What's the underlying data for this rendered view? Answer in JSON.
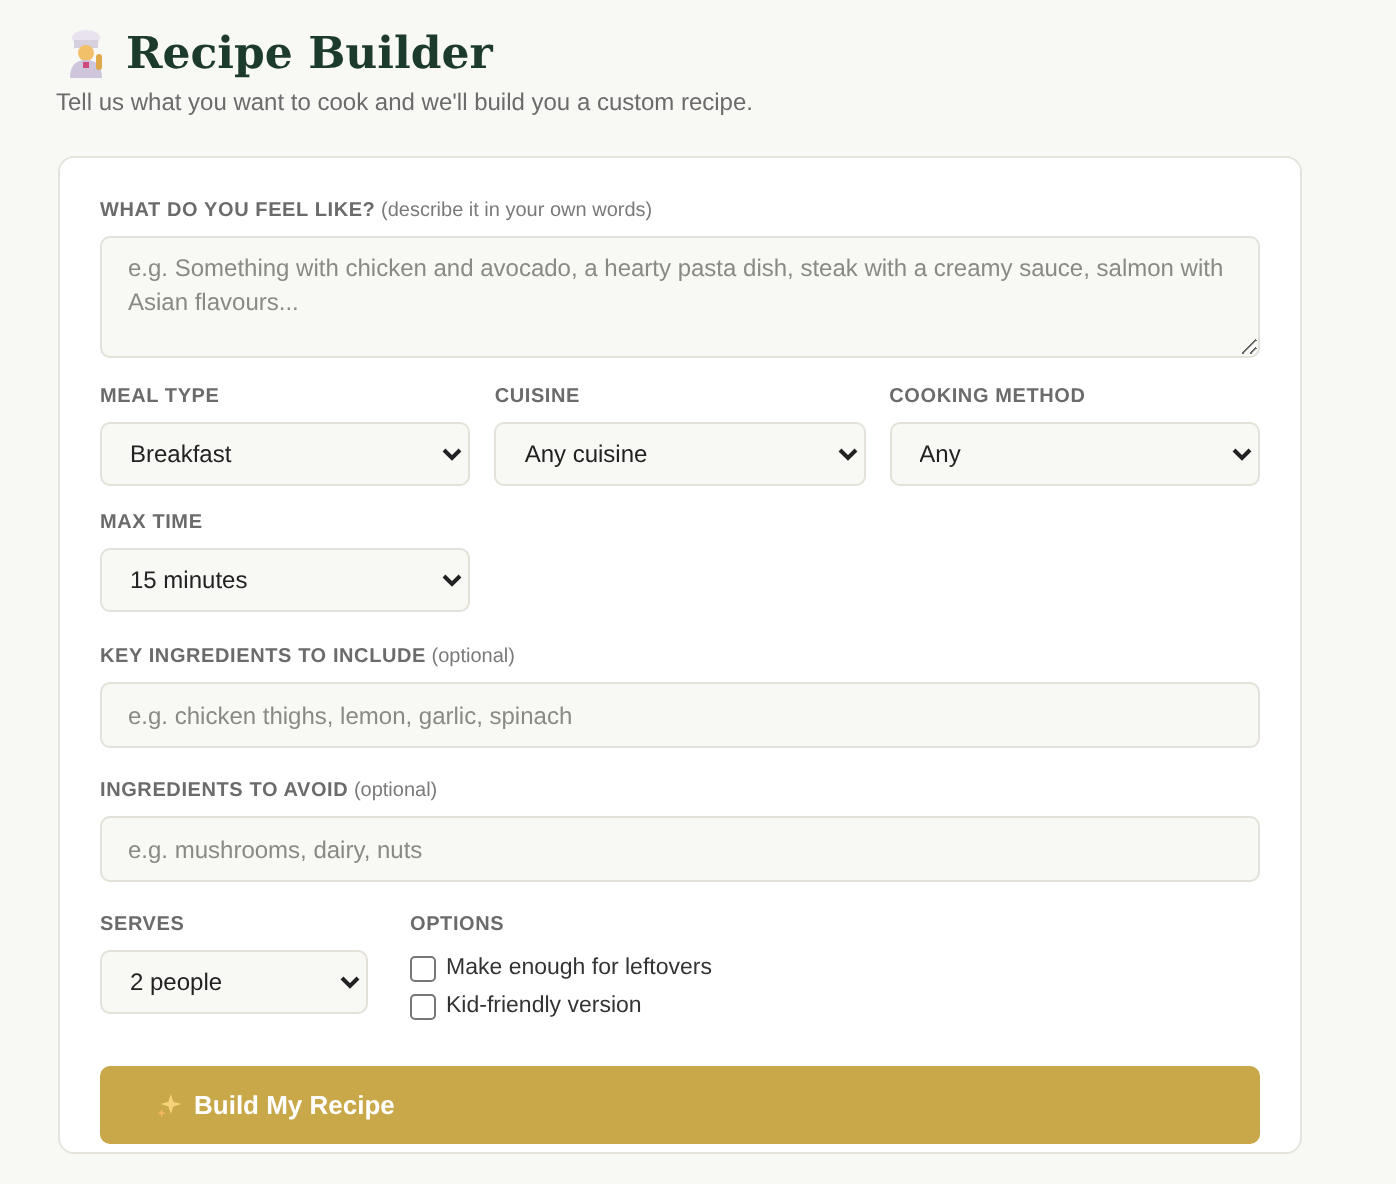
{
  "header": {
    "title": "Recipe Builder",
    "subtitle": "Tell us what you want to cook and we'll build you a custom recipe."
  },
  "description": {
    "label": "WHAT DO YOU FEEL LIKE?",
    "hint": "(describe it in your own words)",
    "placeholder": "e.g. Something with chicken and avocado, a hearty pasta dish, steak with a creamy sauce, salmon with Asian flavours..."
  },
  "selects": [
    {
      "label": "MEAL TYPE",
      "value": "Breakfast"
    },
    {
      "label": "CUISINE",
      "value": "Any cuisine"
    },
    {
      "label": "COOKING METHOD",
      "value": "Any"
    },
    {
      "label": "MAX TIME",
      "value": "15 minutes"
    }
  ],
  "include": {
    "label": "KEY INGREDIENTS TO INCLUDE",
    "hint": "(optional)",
    "placeholder": "e.g. chicken thighs, lemon, garlic, spinach"
  },
  "avoid": {
    "label": "INGREDIENTS TO AVOID",
    "hint": "(optional)",
    "placeholder": "e.g. mushrooms, dairy, nuts"
  },
  "serves": {
    "label": "SERVES",
    "value": "2 people"
  },
  "options": {
    "label": "OPTIONS",
    "items": [
      {
        "label": "Make enough for leftovers",
        "checked": false
      },
      {
        "label": "Kid-friendly version",
        "checked": false
      }
    ]
  },
  "submit": {
    "label": "Build My Recipe"
  }
}
